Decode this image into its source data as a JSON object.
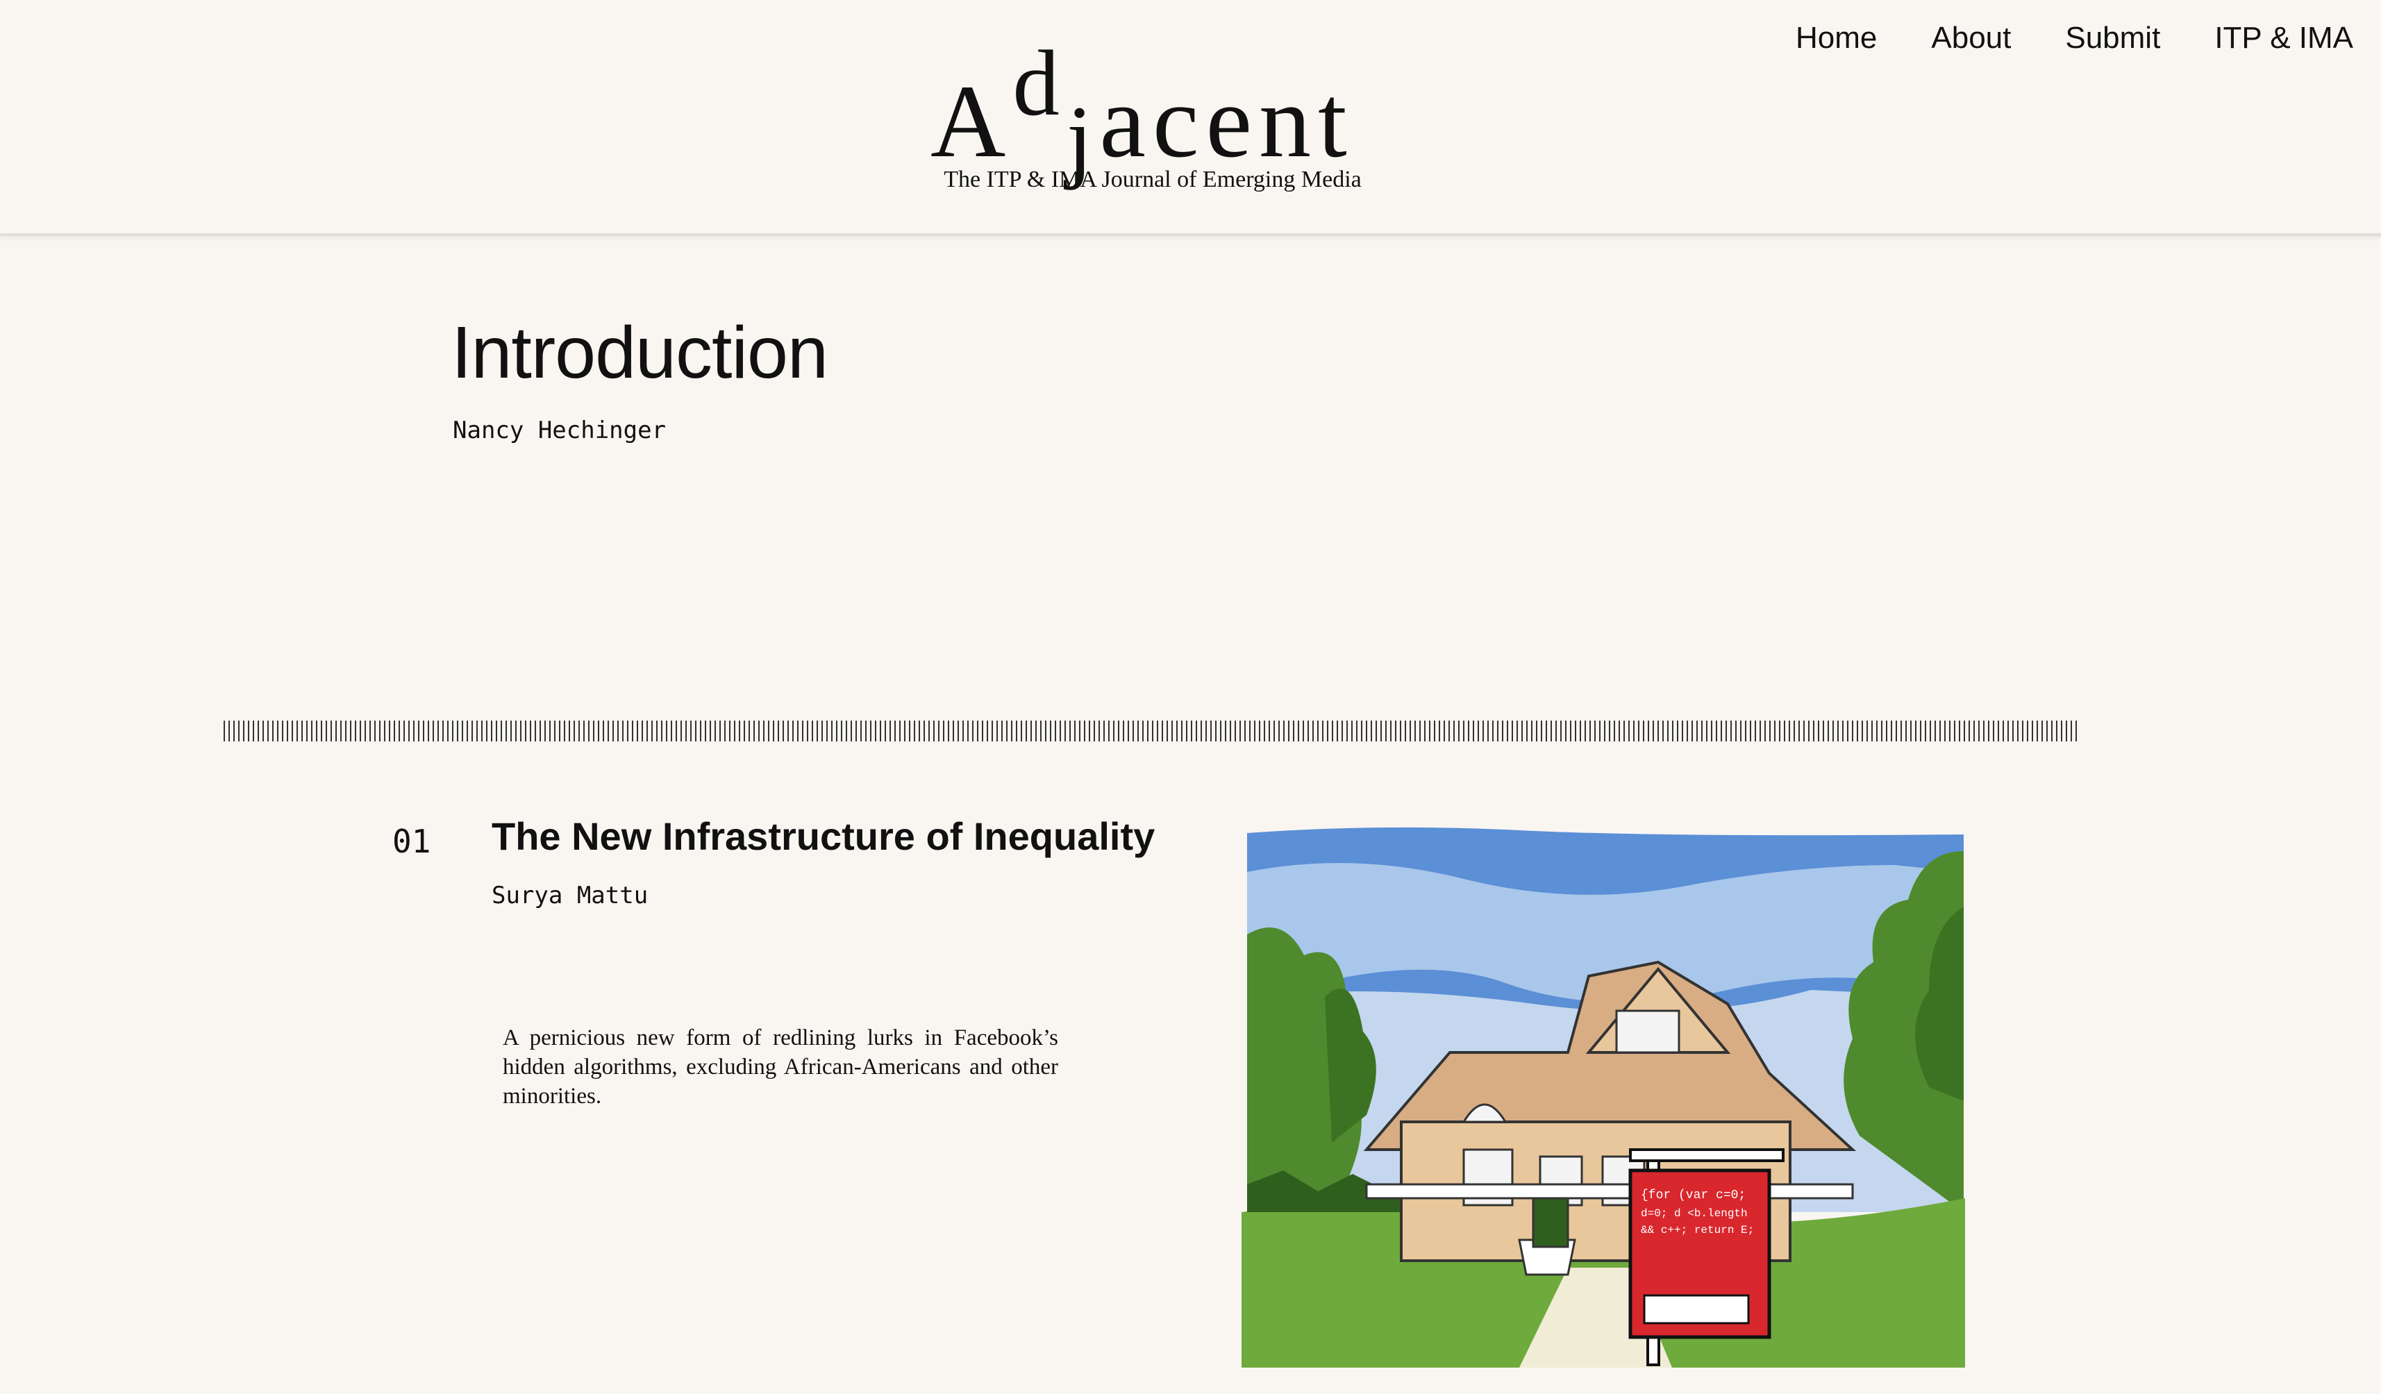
{
  "header": {
    "logo": {
      "letters": [
        "A",
        "d",
        "j",
        "acent"
      ]
    },
    "tagline": "The ITP & IMA Journal of Emerging Media",
    "nav": [
      {
        "label": "Home"
      },
      {
        "label": "About"
      },
      {
        "label": "Submit"
      },
      {
        "label": "ITP & IMA"
      }
    ]
  },
  "intro": {
    "title": "Introduction",
    "author": "Nancy Hechinger"
  },
  "article": {
    "number": "01",
    "title": "The New Infrastructure of Inequality",
    "author": "Surya Mattu",
    "summary": "A pernicious new form of redlining lurks in Facebook’s hidden algorithms, excluding African-Americans and other minorities.",
    "image": {
      "sign_code": [
        "{for (var c=0;",
        "d=0; d <b.length",
        "&& c++; return E;"
      ],
      "colors": {
        "sky": "#5b8fd6",
        "cloud": "#a9c7ea",
        "grass": "#6eaa3c",
        "house": "#e9c79c",
        "roof": "#d8ad84",
        "sign": "#d9272e",
        "trees": "#4f8a2e"
      }
    }
  }
}
